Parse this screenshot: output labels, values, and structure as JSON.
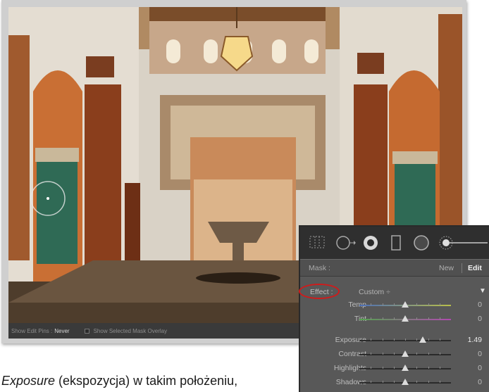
{
  "toolbar": {
    "show_edit_pins_label": "Show Edit Pins :",
    "show_edit_pins_value": "Never",
    "show_mask_overlay_label": "Show Selected Mask Overlay"
  },
  "panel": {
    "mask_label": "Mask :",
    "new_label": "New",
    "edit_label": "Edit",
    "effect_label": "Effect :",
    "effect_preset": "Custom",
    "effect_preset_arrow": "÷",
    "sliders": [
      {
        "label": "Temp",
        "value": "0",
        "position": 0.5
      },
      {
        "label": "Tint",
        "value": "0",
        "position": 0.5
      },
      {
        "label": "Exposure",
        "value": "1.49",
        "position": 0.69
      },
      {
        "label": "Contrast",
        "value": "0",
        "position": 0.5
      },
      {
        "label": "Highlights",
        "value": "0",
        "position": 0.5
      },
      {
        "label": "Shadows",
        "value": "0",
        "position": 0.5
      }
    ],
    "tool_icons": [
      "crop-overlay-icon",
      "spot-removal-icon",
      "red-eye-icon",
      "graduated-filter-icon",
      "radial-filter-icon",
      "adjustment-brush-icon"
    ],
    "highlight_color": "#d11a1a"
  },
  "caption": {
    "italic": "Exposure",
    "rest": " (ekspozycja) w takim położeniu,"
  }
}
